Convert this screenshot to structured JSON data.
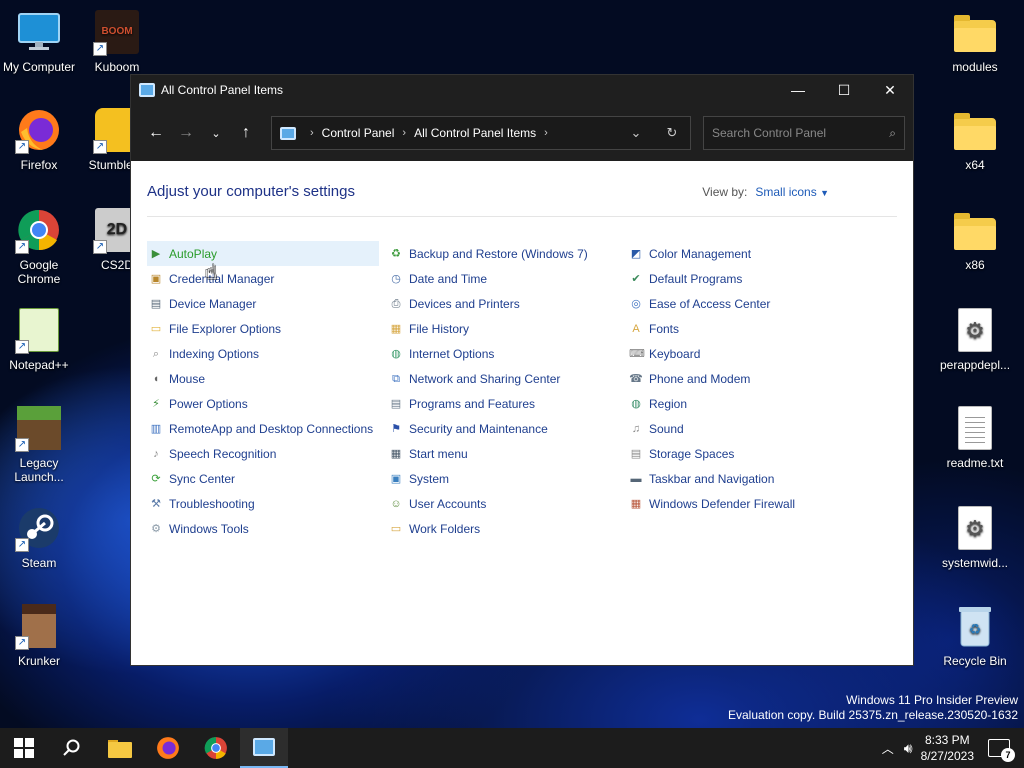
{
  "desktop": {
    "left_icons": [
      {
        "label": "My Computer",
        "icon": "monitor-icon"
      },
      {
        "label": "Kuboom",
        "icon": "game-icon"
      },
      {
        "label": "Firefox",
        "icon": "firefox-icon"
      },
      {
        "label": "Stumble G",
        "icon": "game-icon"
      },
      {
        "label": "Google Chrome",
        "icon": "chrome-icon"
      },
      {
        "label": "CS2D",
        "icon": "game-icon"
      },
      {
        "label": "Notepad++",
        "icon": "notepad-icon"
      },
      {
        "label": "Legacy Launch...",
        "icon": "minecraft-icon"
      },
      {
        "label": "Steam",
        "icon": "steam-icon"
      },
      {
        "label": "Krunker",
        "icon": "game-icon"
      }
    ],
    "right_icons": [
      {
        "label": "modules",
        "icon": "folder-icon"
      },
      {
        "label": "x64",
        "icon": "folder-icon"
      },
      {
        "label": "x86",
        "icon": "folder-icon"
      },
      {
        "label": "perappdepl...",
        "icon": "settings-file-icon"
      },
      {
        "label": "readme.txt",
        "icon": "text-file-icon"
      },
      {
        "label": "systemwid...",
        "icon": "settings-file-icon"
      },
      {
        "label": "Recycle Bin",
        "icon": "recycle-bin-icon"
      }
    ]
  },
  "window": {
    "title": "All Control Panel Items",
    "breadcrumb": [
      "Control Panel",
      "All Control Panel Items"
    ],
    "search_placeholder": "Search Control Panel",
    "heading": "Adjust your computer's settings",
    "view_by_label": "View by:",
    "view_by_value": "Small icons",
    "items": [
      {
        "label": "AutoPlay",
        "icon": "autoplay-icon",
        "color": "#3a8f3a"
      },
      {
        "label": "Credential Manager",
        "icon": "credential-icon",
        "color": "#b8862b"
      },
      {
        "label": "Device Manager",
        "icon": "device-manager-icon",
        "color": "#5a6a7a"
      },
      {
        "label": "File Explorer Options",
        "icon": "folder-options-icon",
        "color": "#e2b23a"
      },
      {
        "label": "Indexing Options",
        "icon": "indexing-icon",
        "color": "#8a8a8a"
      },
      {
        "label": "Mouse",
        "icon": "mouse-icon",
        "color": "#666666"
      },
      {
        "label": "Power Options",
        "icon": "power-icon",
        "color": "#3a8f3a"
      },
      {
        "label": "RemoteApp and Desktop Connections",
        "icon": "remoteapp-icon",
        "color": "#3a6fbf"
      },
      {
        "label": "Speech Recognition",
        "icon": "microphone-icon",
        "color": "#888888"
      },
      {
        "label": "Sync Center",
        "icon": "sync-icon",
        "color": "#3aa03a"
      },
      {
        "label": "Troubleshooting",
        "icon": "troubleshoot-icon",
        "color": "#5a7aa8"
      },
      {
        "label": "Windows Tools",
        "icon": "tools-icon",
        "color": "#8a9aa8"
      },
      {
        "label": "Backup and Restore (Windows 7)",
        "icon": "backup-icon",
        "color": "#3a9a3a"
      },
      {
        "label": "Date and Time",
        "icon": "clock-icon",
        "color": "#4a6fa8"
      },
      {
        "label": "Devices and Printers",
        "icon": "printer-icon",
        "color": "#556677"
      },
      {
        "label": "File History",
        "icon": "file-history-icon",
        "color": "#d6a640"
      },
      {
        "label": "Internet Options",
        "icon": "globe-icon",
        "color": "#3a9a6a"
      },
      {
        "label": "Network and Sharing Center",
        "icon": "network-icon",
        "color": "#3a6fbf"
      },
      {
        "label": "Programs and Features",
        "icon": "programs-icon",
        "color": "#6a7a8a"
      },
      {
        "label": "Security and Maintenance",
        "icon": "flag-icon",
        "color": "#2a4fa8"
      },
      {
        "label": "Start menu",
        "icon": "start-menu-icon",
        "color": "#445566"
      },
      {
        "label": "System",
        "icon": "system-icon",
        "color": "#3a7fbf"
      },
      {
        "label": "User Accounts",
        "icon": "users-icon",
        "color": "#5a8a3a"
      },
      {
        "label": "Work Folders",
        "icon": "work-folders-icon",
        "color": "#d6a640"
      },
      {
        "label": "Color Management",
        "icon": "color-management-icon",
        "color": "#2a5aa8"
      },
      {
        "label": "Default Programs",
        "icon": "default-programs-icon",
        "color": "#3a8a5a"
      },
      {
        "label": "Ease of Access Center",
        "icon": "ease-of-access-icon",
        "color": "#3a6fbf"
      },
      {
        "label": "Fonts",
        "icon": "fonts-icon",
        "color": "#d6a640"
      },
      {
        "label": "Keyboard",
        "icon": "keyboard-icon",
        "color": "#777777"
      },
      {
        "label": "Phone and Modem",
        "icon": "phone-icon",
        "color": "#667788"
      },
      {
        "label": "Region",
        "icon": "region-icon",
        "color": "#3a8f6a"
      },
      {
        "label": "Sound",
        "icon": "sound-icon",
        "color": "#888888"
      },
      {
        "label": "Storage Spaces",
        "icon": "storage-icon",
        "color": "#8a8a8a"
      },
      {
        "label": "Taskbar and Navigation",
        "icon": "taskbar-icon",
        "color": "#556677"
      },
      {
        "label": "Windows Defender Firewall",
        "icon": "firewall-icon",
        "color": "#b8553a"
      }
    ]
  },
  "watermark": {
    "line1": "Windows 11 Pro Insider Preview",
    "line2": "Evaluation copy. Build 25375.zn_release.230520-1632"
  },
  "taskbar": {
    "time": "8:33 PM",
    "date": "8/27/2023",
    "notification_count": "7",
    "apps": [
      "start-icon",
      "search-icon",
      "file-explorer-icon",
      "firefox-icon",
      "chrome-icon",
      "control-panel-icon"
    ]
  }
}
